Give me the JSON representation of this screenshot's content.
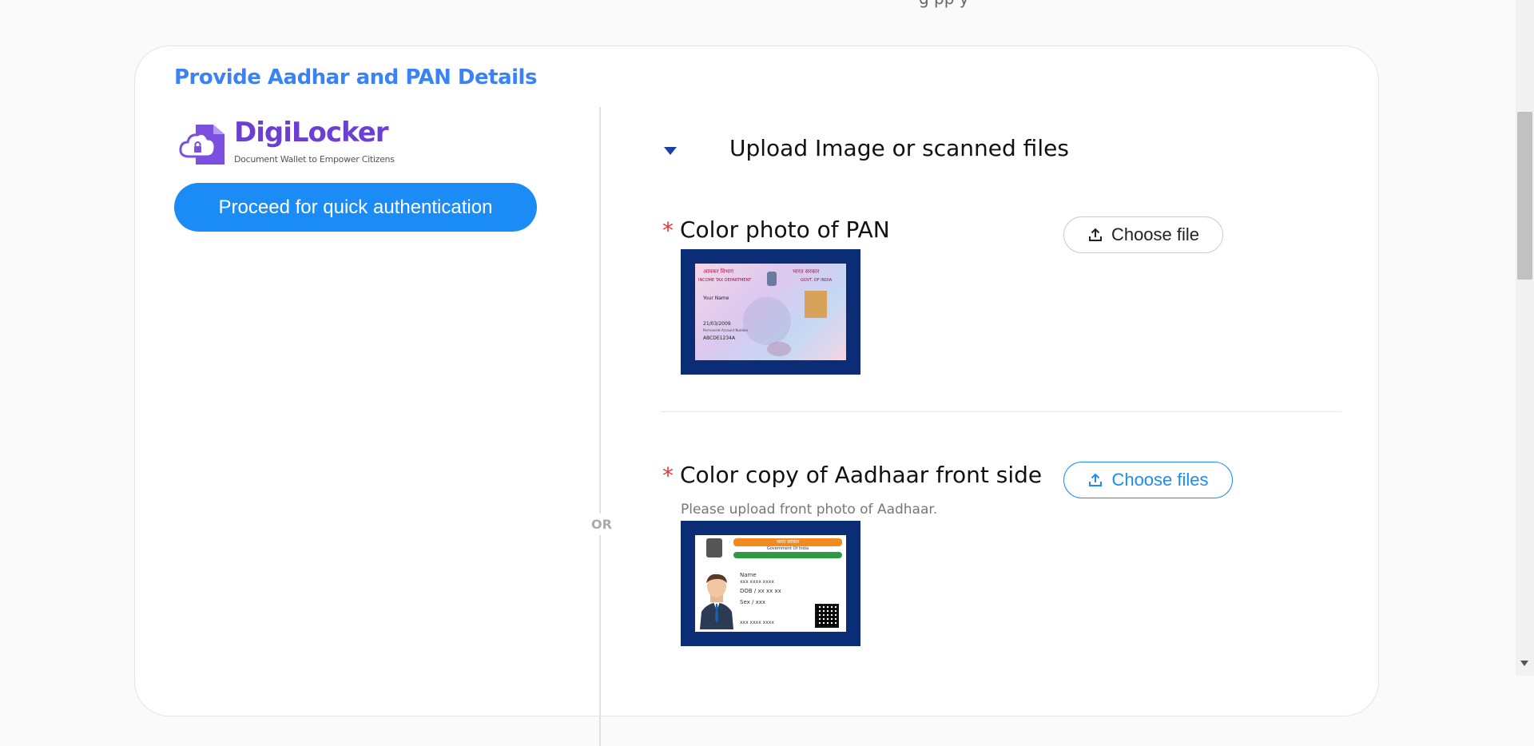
{
  "page": {
    "top_partial_text": "g      pp   y"
  },
  "section": {
    "title": "Provide Aadhar and PAN Details"
  },
  "digilocker": {
    "title": "DigiLocker",
    "tagline": "Document Wallet to Empower Citizens",
    "proceed_label": "Proceed for quick authentication",
    "logo_icon": "cloud-lock-icon"
  },
  "divider": {
    "or_label": "OR"
  },
  "upload": {
    "heading": "Upload Image or scanned files",
    "arrow_icon": "caret-down-icon"
  },
  "pan": {
    "required_mark": "*",
    "label": "Color photo of PAN",
    "button_label": "Choose file",
    "button_icon": "upload-icon",
    "card_texts": {
      "hindi_dept": "आयकर विभाग",
      "hindi_govt": "भारत सरकार",
      "dept": "INCOME TAX DEPARTMENT",
      "govt": "GOVT. OF INDIA",
      "name": "Your Name",
      "dob": "21/03/2009",
      "pan_label": "Permanent Account Number",
      "pan_number": "ABCDE1234A"
    }
  },
  "aadhaar": {
    "required_mark": "*",
    "label": "Color copy of Aadhaar front side",
    "hint": "Please upload front photo of Aadhaar.",
    "button_label": "Choose files",
    "button_icon": "upload-icon",
    "card_texts": {
      "header_hindi": "भारत सरकार",
      "header_en": "Government Of India",
      "name": "Name",
      "name_val": "xxx xxxx xxxx",
      "dob": "DOB /  xx xx xx",
      "sex": "Sex  /   xxx",
      "number": "xxx xxxx xxxx"
    }
  },
  "colors": {
    "accent": "#1b8cf5",
    "title": "#3b82f6",
    "required": "#e53935",
    "thumb_frame": "#0a2d75"
  }
}
